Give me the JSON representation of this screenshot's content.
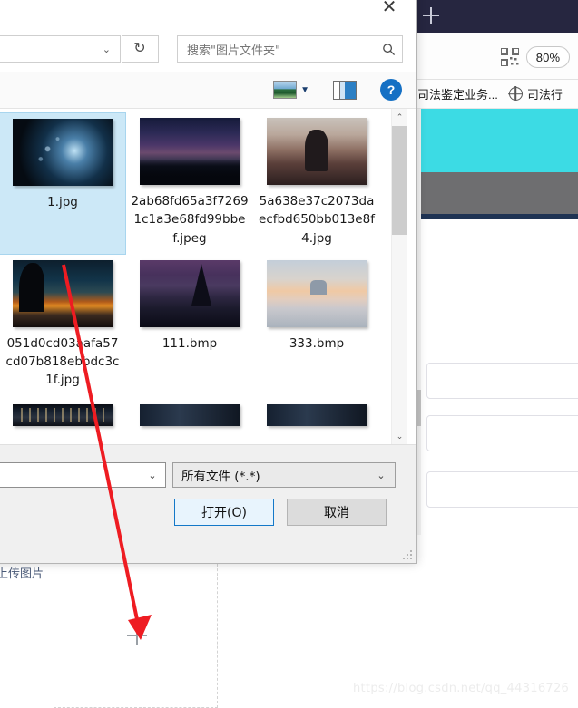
{
  "browser": {
    "new_tab_label": "+",
    "zoom_level": "80%",
    "qr_icon": "qr-code-icon",
    "bookmarks": [
      {
        "label": "司法鉴定业务...",
        "icon": "globe-icon"
      },
      {
        "label": "司法行",
        "icon": "globe-icon"
      }
    ]
  },
  "page": {
    "upload_label": "上传图片",
    "upload_plus": "+",
    "watermark": "https://blog.csdn.net/qq_44316726"
  },
  "dialog": {
    "close_label": "✕",
    "nav": {
      "address_chevron": "⌄",
      "refresh_icon": "refresh-icon",
      "refresh_glyph": "↻",
      "search_placeholder": "搜索\"图片文件夹\"",
      "search_icon": "🔍"
    },
    "toolbar": {
      "view_icon": "picture-view-icon",
      "view_chevron": "▼",
      "preview_pane_icon": "preview-pane-icon",
      "help_label": "?"
    },
    "files": [
      {
        "name": "1.jpg",
        "thumb": "th-ai",
        "selected": true
      },
      {
        "name": "2ab68fd65a3f72691c1a3e68fd99bbef.jpeg",
        "thumb": "th-galaxy",
        "selected": false
      },
      {
        "name": "5a638e37c2073daecfbd650bb013e8f4.jpg",
        "thumb": "th-girl",
        "selected": false
      },
      {
        "name": "051d0cd03aafa57cd07b818ebbdc3c1f.jpg",
        "thumb": "th-sunset",
        "selected": false
      },
      {
        "name": "111.bmp",
        "thumb": "th-pines",
        "selected": false
      },
      {
        "name": "333.bmp",
        "thumb": "th-lake",
        "selected": false
      }
    ],
    "partial_row": [
      {
        "thumb": "th-city"
      },
      {
        "thumb": "th-strip"
      },
      {
        "thumb": "th-strip"
      }
    ],
    "scroll": {
      "up_arrow": "⌃",
      "down_arrow": "⌄"
    },
    "bottom": {
      "filename_value": "",
      "filename_chevron": "⌄",
      "filetype_value": "所有文件 (*.*)",
      "filetype_chevron": "⌄",
      "open_label": "打开(O)",
      "cancel_label": "取消"
    }
  },
  "colors": {
    "accent_blue": "#1478c8",
    "selection_blue": "#cce8f7",
    "annotation_red": "#ee1c22",
    "hero_cyan": "#3cdbe4",
    "titlebar_navy": "#262640"
  }
}
